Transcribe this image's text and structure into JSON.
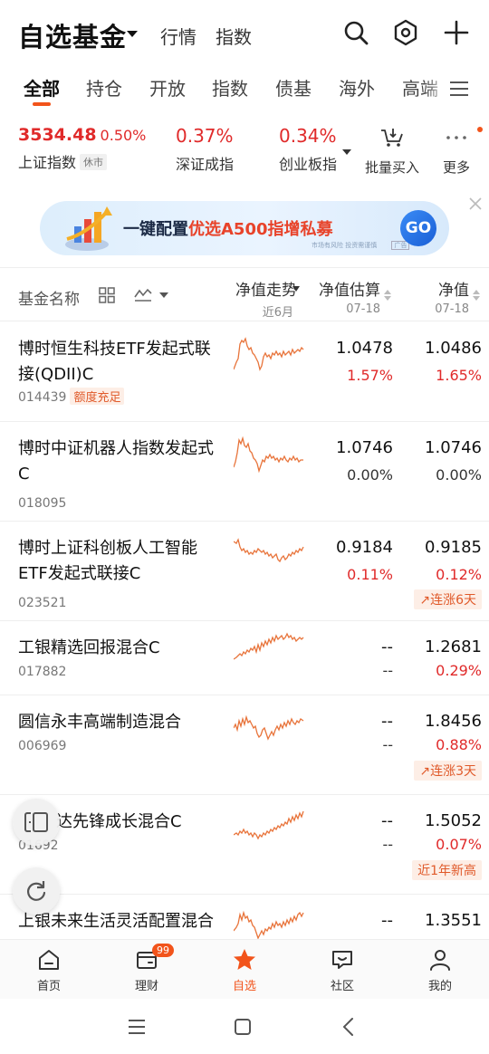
{
  "header": {
    "title": "自选基金",
    "links": [
      "行情",
      "指数"
    ]
  },
  "tabs": [
    "全部",
    "持仓",
    "开放",
    "指数",
    "债基",
    "海外",
    "高端"
  ],
  "indexes": [
    {
      "value": "3534.48",
      "change": "0.50%",
      "name": "上证指数",
      "tag": "休市"
    },
    {
      "value": "",
      "change": "0.37%",
      "name": "深证成指",
      "tag": ""
    },
    {
      "value": "",
      "change": "0.34%",
      "name": "创业板指",
      "tag": ""
    }
  ],
  "tools": {
    "batch_buy": "批量买入",
    "more": "更多"
  },
  "banner": {
    "text_a": "一键配置",
    "text_b": "优选A500指增私募",
    "small": "市场有风险 投资需谨慎",
    "ad": "广告",
    "go": "GO"
  },
  "columns": {
    "name": "基金名称",
    "trend": "净值走势",
    "trend_sub": "近6月",
    "estimate": "净值估算",
    "estimate_date": "07-18",
    "nav": "净值",
    "nav_date": "07-18"
  },
  "funds": [
    {
      "name": "博时恒生科技ETF发起式联接(QDII)C",
      "code": "014439",
      "tag": "额度充足",
      "est": "1.0478",
      "est_pct": "1.57%",
      "nav": "1.0486",
      "nav_pct": "1.65%",
      "badge": ""
    },
    {
      "name": "博时中证机器人指数发起式C",
      "code": "018095",
      "tag": "",
      "est": "1.0746",
      "est_pct": "0.00%",
      "nav": "1.0746",
      "nav_pct": "0.00%",
      "badge": ""
    },
    {
      "name": "博时上证科创板人工智能ETF发起式联接C",
      "code": "023521",
      "tag": "",
      "est": "0.9184",
      "est_pct": "0.11%",
      "nav": "0.9185",
      "nav_pct": "0.12%",
      "badge": "连涨6天"
    },
    {
      "name": "工银精选回报混合C",
      "code": "017882",
      "tag": "",
      "est": "--",
      "est_pct": "--",
      "nav": "1.2681",
      "nav_pct": "0.29%",
      "badge": ""
    },
    {
      "name": "圆信永丰高端制造混合",
      "code": "006969",
      "tag": "",
      "est": "--",
      "est_pct": "--",
      "nav": "1.8456",
      "nav_pct": "0.88%",
      "badge": "连涨3天"
    },
    {
      "name": "达先锋成长混合C",
      "code": "0​1​692",
      "tag": "",
      "est": "--",
      "est_pct": "--",
      "nav": "1.5052",
      "nav_pct": "0.07%",
      "badge": "近1年新高"
    },
    {
      "name": "上银未来生活灵活配置混合C",
      "code": "",
      "tag": "",
      "est": "--",
      "est_pct": "",
      "nav": "1.3551",
      "nav_pct": "",
      "badge": ""
    }
  ],
  "bottom_nav": [
    {
      "label": "首页",
      "icon": "home-icon"
    },
    {
      "label": "理财",
      "icon": "wallet-icon",
      "badge": "99"
    },
    {
      "label": "自选",
      "icon": "star-icon"
    },
    {
      "label": "社区",
      "icon": "chat-icon"
    },
    {
      "label": "我的",
      "icon": "user-icon"
    }
  ],
  "colors": {
    "accent": "#f2541b",
    "up": "#e02a2a",
    "down": "#14a05a",
    "spark": "#e8743b"
  }
}
